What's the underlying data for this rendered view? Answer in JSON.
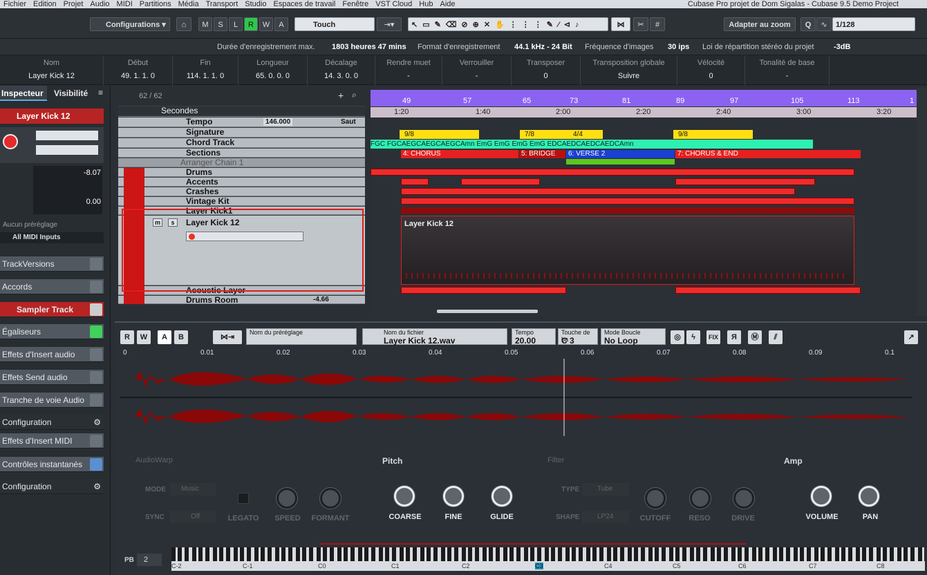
{
  "menu": {
    "items": [
      "Fichier",
      "Edition",
      "Projet",
      "Audio",
      "MIDI",
      "Partitions",
      "Média",
      "Transport",
      "Studio",
      "Espaces de travail",
      "Fenêtre",
      "VST Cloud",
      "Hub",
      "Aide"
    ],
    "window_title": "Cubase Pro projet de Dom Sigalas - Cubase 9.5 Demo Project"
  },
  "toolbar": {
    "configurations": "Configurations",
    "m": "M",
    "s": "S",
    "l": "L",
    "r": "R",
    "w": "W",
    "a": "A",
    "touch": "Touch",
    "zoom": "Adapter au zoom",
    "quantize": "1/128"
  },
  "status": {
    "rec_time_label": "Durée d'enregistrement max.",
    "rec_time": "1803 heures 47 mins",
    "format_label": "Format d'enregistrement",
    "format": "44.1 kHz - 24 Bit",
    "fps_label": "Fréquence d'images",
    "fps": "30 ips",
    "pan_label": "Loi de répartition stéréo du projet",
    "pan": "-3dB"
  },
  "info": {
    "cols": [
      {
        "h": "Nom",
        "v": "Layer Kick 12"
      },
      {
        "h": "Début",
        "v": "49. 1. 1. 0"
      },
      {
        "h": "Fin",
        "v": "114. 1. 1. 0"
      },
      {
        "h": "Longueur",
        "v": "65. 0. 0. 0"
      },
      {
        "h": "Décalage",
        "v": "14. 3. 0. 0"
      },
      {
        "h": "Rendre muet",
        "v": "-"
      },
      {
        "h": "Verrouiller",
        "v": "-"
      },
      {
        "h": "Transposer",
        "v": "0"
      },
      {
        "h": "Transposition globale",
        "v": "Suivre"
      },
      {
        "h": "Vélocité",
        "v": "0"
      },
      {
        "h": "Tonalité de base",
        "v": "-"
      }
    ]
  },
  "inspector": {
    "tab1": "Inspecteur",
    "tab2": "Visibilité",
    "track": "Layer Kick 12",
    "vol": "-8.07",
    "pan": "0.00",
    "preset": "Aucun préréglage",
    "midi_in": "All MIDI Inputs",
    "sections": [
      "TrackVersions",
      "Accords",
      "Sampler Track",
      "Égaliseurs",
      "Effets d'Insert audio",
      "Effets Send audio",
      "Tranche de voie Audio",
      "Configuration",
      "Effets d'Insert MIDI",
      "Contrôles instantanés",
      "Configuration"
    ]
  },
  "tracklist": {
    "count": "62 / 62",
    "timebase": "Secondes",
    "tempo": "Tempo",
    "tempo_val": "146.000",
    "saut": "Saut",
    "signature": "Signature",
    "chord": "Chord Track",
    "sections": "Sections",
    "arranger": "Arranger Chain 1",
    "drums": "Drums",
    "accents": "Accents",
    "crashes": "Crashes",
    "vintage": "Vintage Kit",
    "layer1": "Layer Kick1",
    "layer12": "Layer Kick 12",
    "acoustic": "Acoustic Layer",
    "room": "Drums Room",
    "room_val": "-4.66"
  },
  "ruler": {
    "bars": [
      "49",
      "57",
      "65",
      "73",
      "81",
      "89",
      "97",
      "105",
      "113",
      "1"
    ],
    "times": [
      "1:20",
      "1:40",
      "2:00",
      "2:20",
      "2:40",
      "3:00",
      "3:20"
    ]
  },
  "signatures": [
    "9/8",
    "7/8",
    "4/4",
    "9/8"
  ],
  "chords": "FGC FGCAEGCAEGCAEGCAmn EmG EmG EmG EmG EDCAEDCAEDCAEDCAmn",
  "sections": [
    "4: CHORUS",
    "5: BRIDGE",
    "6: VERSE 2",
    "7: CHORUS & END"
  ],
  "event_label": "Layer Kick 12",
  "editor": {
    "r": "R",
    "w": "W",
    "a": "A",
    "b": "B",
    "preset_label": "Nom du préréglage",
    "file_label": "Nom du fichier",
    "file": "Layer Kick 12.wav",
    "tempo_label": "Tempo",
    "tempo": "20.00",
    "key_label": "Touche de ba",
    "key": "C 3",
    "loop_label": "Mode Boucle",
    "loop": "No Loop",
    "fix": "FIX",
    "ruler": [
      "0",
      "0.01",
      "0.02",
      "0.03",
      "0.04",
      "0.05",
      "0.06",
      "0.07",
      "0.08",
      "0.09",
      "0.1"
    ],
    "audiowarp": "AudioWarp",
    "pitch": "Pitch",
    "filter": "Filter",
    "amp": "Amp",
    "mode": "MODE",
    "mode_val": "Music",
    "sync": "SYNC",
    "sync_val": "Off",
    "legato": "LEGATO",
    "speed": "SPEED",
    "formant": "FORMANT",
    "coarse": "COARSE",
    "fine": "FINE",
    "glide": "GLIDE",
    "type": "TYPE",
    "type_val": "Tube",
    "shape": "SHAPE",
    "shape_val": "LP24",
    "cutoff": "CUTOFF",
    "reso": "RESO",
    "drive": "DRIVE",
    "volume": "VOLUME",
    "pan": "PAN",
    "pb": "PB",
    "pb_val": "2",
    "octaves": [
      "C-2",
      "C-1",
      "C0",
      "C1",
      "C2",
      "C3",
      "C4",
      "C5",
      "C6",
      "C7",
      "C8"
    ]
  },
  "colors": {
    "accent_red": "#ef2b2b",
    "arranger": "#8b63f0",
    "marker": "#ffdf10",
    "chord": "#2ef0b0",
    "selected": "#dd0000"
  }
}
